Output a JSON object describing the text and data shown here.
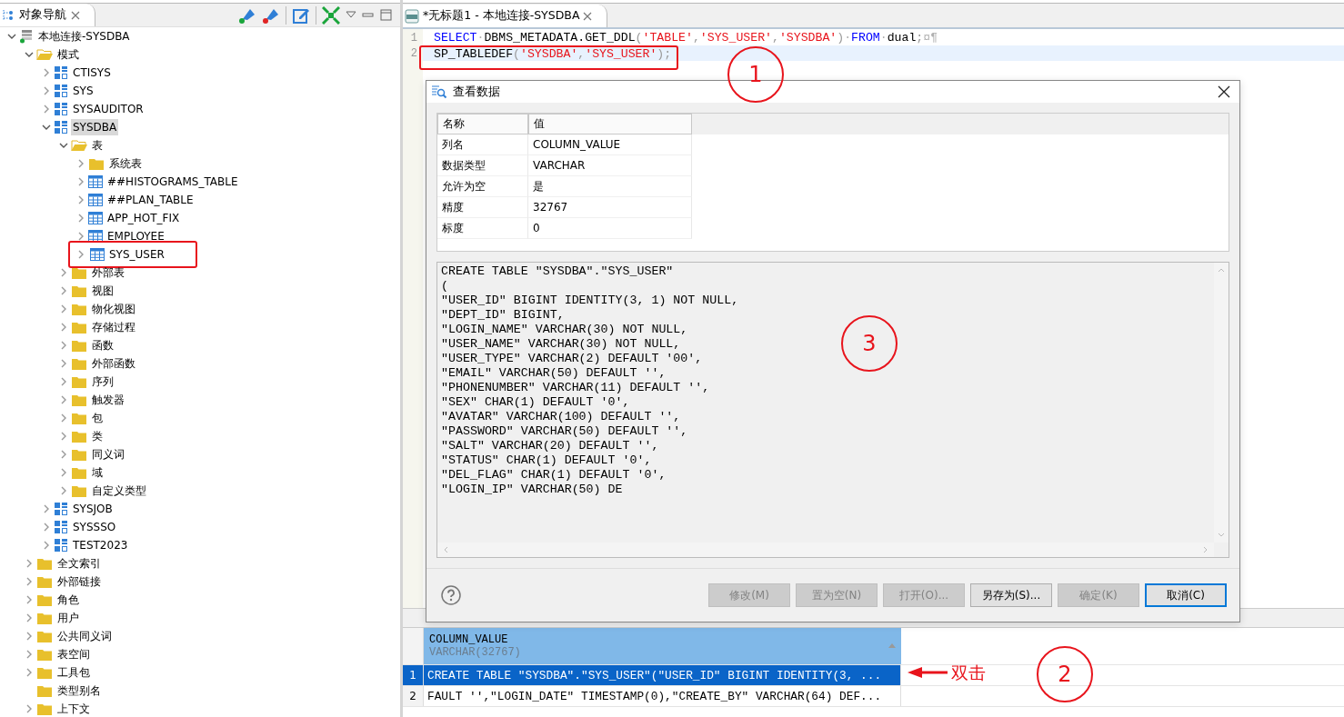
{
  "navigator": {
    "title": "对象导航"
  },
  "tree": [
    {
      "label": "本地连接-SYSDBA",
      "kind": "connection",
      "expanded": true,
      "children": [
        {
          "label": "模式",
          "kind": "folder",
          "expanded": true,
          "children": [
            {
              "label": "CTISYS",
              "kind": "schema",
              "expanded": false
            },
            {
              "label": "SYS",
              "kind": "schema",
              "expanded": false
            },
            {
              "label": "SYSAUDITOR",
              "kind": "schema",
              "expanded": false
            },
            {
              "label": "SYSDBA",
              "kind": "schema",
              "expanded": true,
              "selected": true,
              "children": [
                {
                  "label": "表",
                  "kind": "folder",
                  "expanded": true,
                  "children": [
                    {
                      "label": "系统表",
                      "kind": "folder",
                      "expanded": false,
                      "boxed": false
                    },
                    {
                      "label": "##HISTOGRAMS_TABLE",
                      "kind": "table",
                      "expanded": false,
                      "boxed": false
                    },
                    {
                      "label": "##PLAN_TABLE",
                      "kind": "table",
                      "expanded": false,
                      "boxed": false
                    },
                    {
                      "label": "APP_HOT_FIX",
                      "kind": "table",
                      "expanded": false,
                      "boxed": false
                    },
                    {
                      "label": "EMPLOYEE",
                      "kind": "table",
                      "expanded": false,
                      "boxed": false
                    },
                    {
                      "label": "SYS_USER",
                      "kind": "table",
                      "expanded": false,
                      "boxed": true
                    }
                  ]
                },
                {
                  "label": "外部表",
                  "kind": "folder",
                  "expanded": false
                },
                {
                  "label": "视图",
                  "kind": "folder",
                  "expanded": false
                },
                {
                  "label": "物化视图",
                  "kind": "folder",
                  "expanded": false
                },
                {
                  "label": "存储过程",
                  "kind": "folder",
                  "expanded": false
                },
                {
                  "label": "函数",
                  "kind": "folder",
                  "expanded": false
                },
                {
                  "label": "外部函数",
                  "kind": "folder",
                  "expanded": false
                },
                {
                  "label": "序列",
                  "kind": "folder",
                  "expanded": false
                },
                {
                  "label": "触发器",
                  "kind": "folder",
                  "expanded": false
                },
                {
                  "label": "包",
                  "kind": "folder",
                  "expanded": false
                },
                {
                  "label": "类",
                  "kind": "folder",
                  "expanded": false
                },
                {
                  "label": "同义词",
                  "kind": "folder",
                  "expanded": false
                },
                {
                  "label": "域",
                  "kind": "folder",
                  "expanded": false
                },
                {
                  "label": "自定义类型",
                  "kind": "folder",
                  "expanded": false
                }
              ]
            },
            {
              "label": "SYSJOB",
              "kind": "schema",
              "expanded": false
            },
            {
              "label": "SYSSSO",
              "kind": "schema",
              "expanded": false
            },
            {
              "label": "TEST2023",
              "kind": "schema",
              "expanded": false
            }
          ]
        },
        {
          "label": "全文索引",
          "kind": "folder",
          "expanded": false
        },
        {
          "label": "外部链接",
          "kind": "folder",
          "expanded": false
        },
        {
          "label": "角色",
          "kind": "folder",
          "expanded": false
        },
        {
          "label": "用户",
          "kind": "folder",
          "expanded": false
        },
        {
          "label": "公共同义词",
          "kind": "folder",
          "expanded": false
        },
        {
          "label": "表空间",
          "kind": "folder",
          "expanded": false
        },
        {
          "label": "工具包",
          "kind": "folder",
          "expanded": false
        },
        {
          "label": "类型别名",
          "kind": "folder",
          "expanded": false,
          "expandable": false
        },
        {
          "label": "上下文",
          "kind": "folder",
          "expanded": false
        }
      ]
    }
  ],
  "editor": {
    "tab_title": "*无标题1 - 本地连接-SYSDBA",
    "lines": [
      {
        "number": "1",
        "current": false,
        "boxed": false,
        "tokens": [
          {
            "kind": "keyword",
            "text": "SELECT"
          },
          {
            "kind": "space",
            "text": "·"
          },
          {
            "kind": "plain",
            "text": "DBMS_METADATA.GET_DDL"
          },
          {
            "kind": "punct",
            "text": "("
          },
          {
            "kind": "string",
            "text": "'TABLE'"
          },
          {
            "kind": "punct",
            "text": ","
          },
          {
            "kind": "string",
            "text": "'SYS_USER'"
          },
          {
            "kind": "punct",
            "text": ","
          },
          {
            "kind": "string",
            "text": "'SYSDBA'"
          },
          {
            "kind": "punct",
            "text": ")"
          },
          {
            "kind": "space",
            "text": "·"
          },
          {
            "kind": "keyword",
            "text": "FROM"
          },
          {
            "kind": "space",
            "text": "·"
          },
          {
            "kind": "plain",
            "text": "dual"
          },
          {
            "kind": "punct",
            "text": ";"
          },
          {
            "kind": "space",
            "text": "¤¶"
          }
        ]
      },
      {
        "number": "2",
        "current": true,
        "boxed": true,
        "tokens": [
          {
            "kind": "plain",
            "text": "SP_TABLEDEF"
          },
          {
            "kind": "punct",
            "text": "("
          },
          {
            "kind": "string",
            "text": "'SYSDBA'"
          },
          {
            "kind": "punct",
            "text": ","
          },
          {
            "kind": "string",
            "text": "'SYS_USER'"
          },
          {
            "kind": "punct",
            "text": ");"
          }
        ]
      }
    ]
  },
  "dialog": {
    "title": "查看数据",
    "properties": {
      "columns": [
        "名称",
        "值"
      ],
      "rows": [
        [
          "列名",
          "COLUMN_VALUE"
        ],
        [
          "数据类型",
          "VARCHAR"
        ],
        [
          "允许为空",
          "是"
        ],
        [
          "精度",
          "32767"
        ],
        [
          "标度",
          "0"
        ]
      ]
    },
    "content": [
      "CREATE TABLE \"SYSDBA\".\"SYS_USER\"",
      "(",
      "\"USER_ID\" BIGINT IDENTITY(3, 1) NOT NULL,",
      "\"DEPT_ID\" BIGINT,",
      "\"LOGIN_NAME\" VARCHAR(30) NOT NULL,",
      "\"USER_NAME\" VARCHAR(30) NOT NULL,",
      "\"USER_TYPE\" VARCHAR(2) DEFAULT '00',",
      "\"EMAIL\" VARCHAR(50) DEFAULT '',",
      "\"PHONENUMBER\" VARCHAR(11) DEFAULT '',",
      "\"SEX\" CHAR(1) DEFAULT '0',",
      "\"AVATAR\" VARCHAR(100) DEFAULT '',",
      "\"PASSWORD\" VARCHAR(50) DEFAULT '',",
      "\"SALT\" VARCHAR(20) DEFAULT '',",
      "\"STATUS\" CHAR(1) DEFAULT '0',",
      "\"DEL_FLAG\" CHAR(1) DEFAULT '0',",
      "\"LOGIN_IP\" VARCHAR(50) DE"
    ],
    "buttons": [
      {
        "label": "修改(M)",
        "disabled": true,
        "default": false
      },
      {
        "label": "置为空(N)",
        "disabled": true,
        "default": false
      },
      {
        "label": "打开(O)...",
        "disabled": true,
        "default": false
      },
      {
        "label": "另存为(S)...",
        "disabled": false,
        "default": false
      },
      {
        "label": "确定(K)",
        "disabled": true,
        "default": false
      },
      {
        "label": "取消(C)",
        "disabled": false,
        "default": true
      }
    ]
  },
  "results": {
    "columns": [
      {
        "name": "COLUMN_VALUE",
        "type": "VARCHAR(32767)"
      }
    ],
    "rows": [
      {
        "number": "1",
        "value": "CREATE TABLE \"SYSDBA\".\"SYS_USER\"(\"USER_ID\" BIGINT IDENTITY(3, ...",
        "selected": true
      },
      {
        "number": "2",
        "value": "FAULT '',\"LOGIN_DATE\" TIMESTAMP(0),\"CREATE_BY\" VARCHAR(64) DEF...",
        "selected": false
      }
    ]
  },
  "annotations": {
    "callouts": [
      "1",
      "3",
      "2"
    ],
    "arrow_label": "双击"
  }
}
